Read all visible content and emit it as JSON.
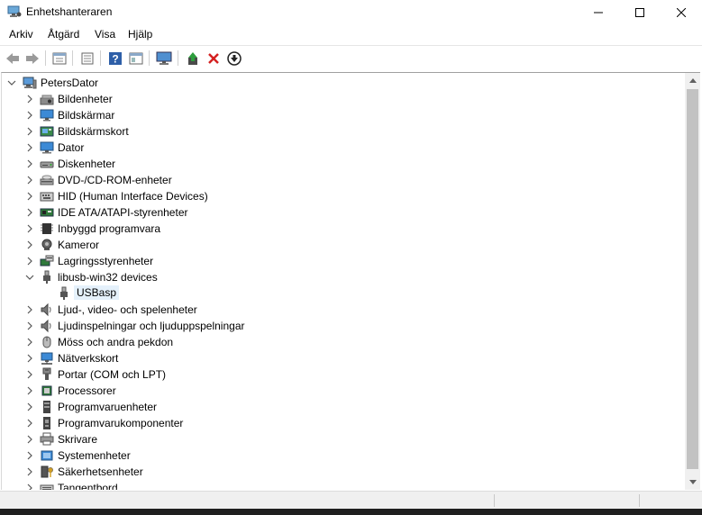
{
  "window": {
    "title": "Enhetshanteraren"
  },
  "menu": {
    "items": [
      "Arkiv",
      "Åtgärd",
      "Visa",
      "Hjälp"
    ]
  },
  "toolbar": {
    "buttons": [
      "back-arrow-icon",
      "forward-arrow-icon",
      "properties-sheet-icon",
      "window-list-icon",
      "help-icon",
      "view-panel-icon",
      "monitor-icon",
      "update-driver-icon",
      "uninstall-x-icon",
      "disable-device-icon"
    ]
  },
  "tree": {
    "root": "PetersDator",
    "categories": [
      {
        "label": "Bildenheter",
        "icon": "camera-scanner-icon",
        "expanded": false
      },
      {
        "label": "Bildskärmar",
        "icon": "monitor-icon",
        "expanded": false
      },
      {
        "label": "Bildskärmskort",
        "icon": "display-adapter-icon",
        "expanded": false
      },
      {
        "label": "Dator",
        "icon": "computer-icon",
        "expanded": false
      },
      {
        "label": "Diskenheter",
        "icon": "disk-drive-icon",
        "expanded": false
      },
      {
        "label": "DVD-/CD-ROM-enheter",
        "icon": "dvd-drive-icon",
        "expanded": false
      },
      {
        "label": "HID (Human Interface Devices)",
        "icon": "hid-keyboard-icon",
        "expanded": false
      },
      {
        "label": "IDE ATA/ATAPI-styrenheter",
        "icon": "ide-controller-icon",
        "expanded": false
      },
      {
        "label": "Inbyggd programvara",
        "icon": "firmware-chip-icon",
        "expanded": false
      },
      {
        "label": "Kameror",
        "icon": "webcam-icon",
        "expanded": false
      },
      {
        "label": "Lagringsstyrenheter",
        "icon": "storage-controller-icon",
        "expanded": false
      },
      {
        "label": "libusb-win32 devices",
        "icon": "usb-plug-icon",
        "expanded": true
      },
      {
        "label": "USBasp",
        "icon": "usb-plug-icon",
        "child": true,
        "selected": true
      },
      {
        "label": "Ljud-, video- och spelenheter",
        "icon": "speaker-icon",
        "expanded": false
      },
      {
        "label": "Ljudinspelningar och ljuduppspelningar",
        "icon": "speaker-icon",
        "expanded": false
      },
      {
        "label": "Möss och andra pekdon",
        "icon": "mouse-icon",
        "expanded": false
      },
      {
        "label": "Nätverkskort",
        "icon": "network-adapter-icon",
        "expanded": false
      },
      {
        "label": "Portar (COM och LPT)",
        "icon": "port-icon",
        "expanded": false
      },
      {
        "label": "Processorer",
        "icon": "processor-chip-icon",
        "expanded": false
      },
      {
        "label": "Programvaruenheter",
        "icon": "software-device-icon",
        "expanded": false
      },
      {
        "label": "Programvarukomponenter",
        "icon": "software-component-icon",
        "expanded": false
      },
      {
        "label": "Skrivare",
        "icon": "printer-icon",
        "expanded": false
      },
      {
        "label": "Systemenheter",
        "icon": "system-device-icon",
        "expanded": false
      },
      {
        "label": "Säkerhetsenheter",
        "icon": "security-key-icon",
        "expanded": false
      },
      {
        "label": "Tangentbord",
        "icon": "keyboard-icon",
        "expanded": false
      }
    ]
  }
}
